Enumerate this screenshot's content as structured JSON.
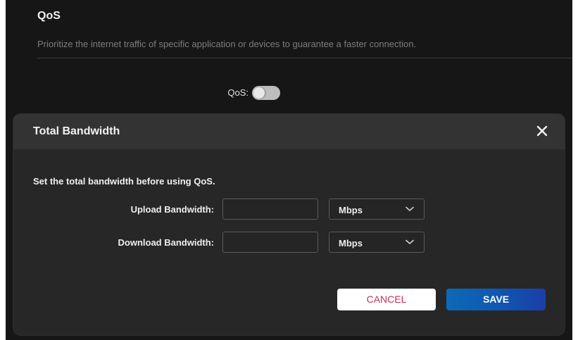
{
  "page": {
    "title": "QoS",
    "description": "Prioritize the internet traffic of specific application or devices to guarantee a faster connection."
  },
  "qos": {
    "label": "QoS:",
    "enabled": false
  },
  "modal": {
    "title": "Total Bandwidth",
    "close_icon": "close-icon",
    "note": "Set the total bandwidth before using QoS.",
    "upload": {
      "label": "Upload Bandwidth:",
      "value": "",
      "unit": "Mbps"
    },
    "download": {
      "label": "Download Bandwidth:",
      "value": "",
      "unit": "Mbps"
    },
    "cancel_label": "CANCEL",
    "save_label": "SAVE"
  },
  "colors": {
    "background": "#161616",
    "modal": "#272727",
    "cancel_text": "#c5305a",
    "save_button": "#0d69b5"
  }
}
